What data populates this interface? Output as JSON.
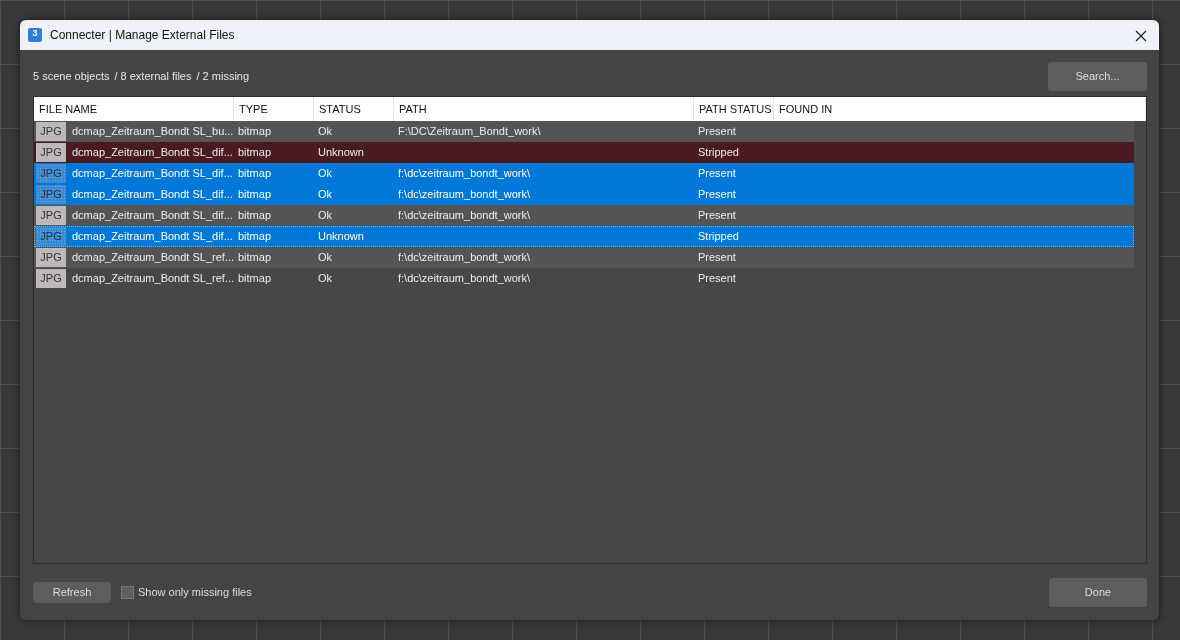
{
  "window": {
    "title": "Connecter | Manage External Files",
    "icon_text": "3"
  },
  "summary": {
    "scene_objects": "5 scene objects",
    "external_files": "/ 8 external files",
    "missing": "/ 2 missing"
  },
  "search_button": "Search...",
  "table": {
    "columns": [
      "FILE NAME",
      "TYPE",
      "STATUS",
      "PATH",
      "PATH STATUS",
      "FOUND IN"
    ],
    "rows": [
      {
        "thumb": "JPG",
        "file_name": "dcmap_Zeitraum_Bondt SL_bu...",
        "type": "bitmap",
        "status": "Ok",
        "path": "F:\\DC\\Zeitraum_Bondt_work\\",
        "path_status": "Present",
        "selected": false,
        "missing": false,
        "focused": false
      },
      {
        "thumb": "JPG",
        "file_name": "dcmap_Zeitraum_Bondt SL_dif...",
        "type": "bitmap",
        "status": "Unknown",
        "path": "",
        "path_status": "Stripped",
        "selected": false,
        "missing": true,
        "focused": false
      },
      {
        "thumb": "JPG",
        "file_name": "dcmap_Zeitraum_Bondt SL_dif...",
        "type": "bitmap",
        "status": "Ok",
        "path": "f:\\dc\\zeitraum_bondt_work\\",
        "path_status": "Present",
        "selected": true,
        "focused": false
      },
      {
        "thumb": "JPG",
        "file_name": "dcmap_Zeitraum_Bondt SL_dif...",
        "type": "bitmap",
        "status": "Ok",
        "path": "f:\\dc\\zeitraum_bondt_work\\",
        "path_status": "Present",
        "selected": true,
        "focused": false
      },
      {
        "thumb": "JPG",
        "file_name": "dcmap_Zeitraum_Bondt SL_dif...",
        "type": "bitmap",
        "status": "Ok",
        "path": "f:\\dc\\zeitraum_bondt_work\\",
        "path_status": "Present",
        "selected": false,
        "missing": false,
        "focused": false
      },
      {
        "thumb": "JPG",
        "file_name": "dcmap_Zeitraum_Bondt SL_dif...",
        "type": "bitmap",
        "status": "Unknown",
        "path": "",
        "path_status": "Stripped",
        "selected": true,
        "focused": true
      },
      {
        "thumb": "JPG",
        "file_name": "dcmap_Zeitraum_Bondt SL_ref...",
        "type": "bitmap",
        "status": "Ok",
        "path": "f:\\dc\\zeitraum_bondt_work\\",
        "path_status": "Present",
        "selected": false,
        "missing": false,
        "focused": false
      },
      {
        "thumb": "JPG",
        "file_name": "dcmap_Zeitraum_Bondt SL_ref...",
        "type": "bitmap",
        "status": "Ok",
        "path": "f:\\dc\\zeitraum_bondt_work\\",
        "path_status": "Present",
        "selected": false,
        "missing": false,
        "focused": false
      }
    ]
  },
  "footer": {
    "refresh_button": "Refresh",
    "show_missing": {
      "label": "Show only missing files",
      "checked": false
    },
    "done_button": "Done"
  }
}
